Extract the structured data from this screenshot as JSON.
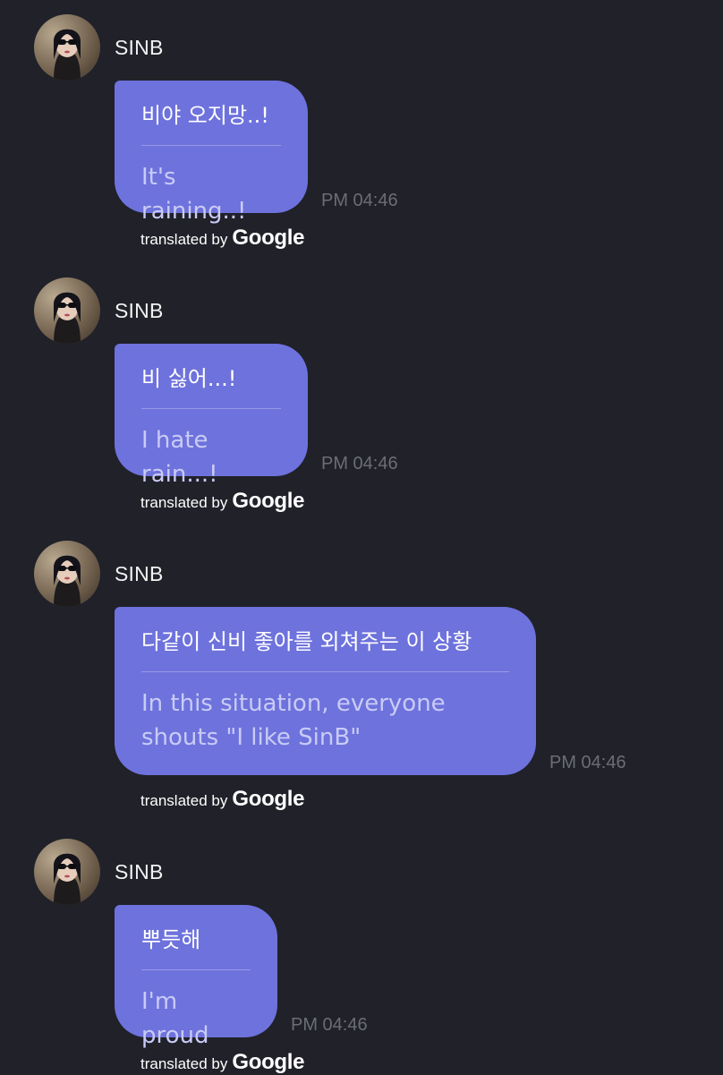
{
  "messages": [
    {
      "sender": "SINB",
      "original": "비야 오지망..!",
      "translation": "It's raining..!",
      "time": "PM 04:46",
      "attribution_label": "translated by",
      "attribution_brand": "Google"
    },
    {
      "sender": "SINB",
      "original": "비 싫어...!",
      "translation": "I hate rain...!",
      "time": "PM 04:46",
      "attribution_label": "translated by",
      "attribution_brand": "Google"
    },
    {
      "sender": "SINB",
      "original": "다같이 신비 좋아를 외쳐주는 이 상황",
      "translation": "In this situation, everyone shouts \"I like SinB\"",
      "time": "PM 04:46",
      "attribution_label": "translated by",
      "attribution_brand": "Google"
    },
    {
      "sender": "SINB",
      "original": "뿌듯해",
      "translation": "I'm proud",
      "time": "PM 04:46",
      "attribution_label": "translated by",
      "attribution_brand": "Google"
    }
  ],
  "colors": {
    "background": "#202129",
    "bubble": "#6e72dc",
    "translation_text": "#c9cbf6",
    "timestamp": "#6b6d77"
  },
  "icons": {
    "avatar": "profile-photo-avatar"
  }
}
